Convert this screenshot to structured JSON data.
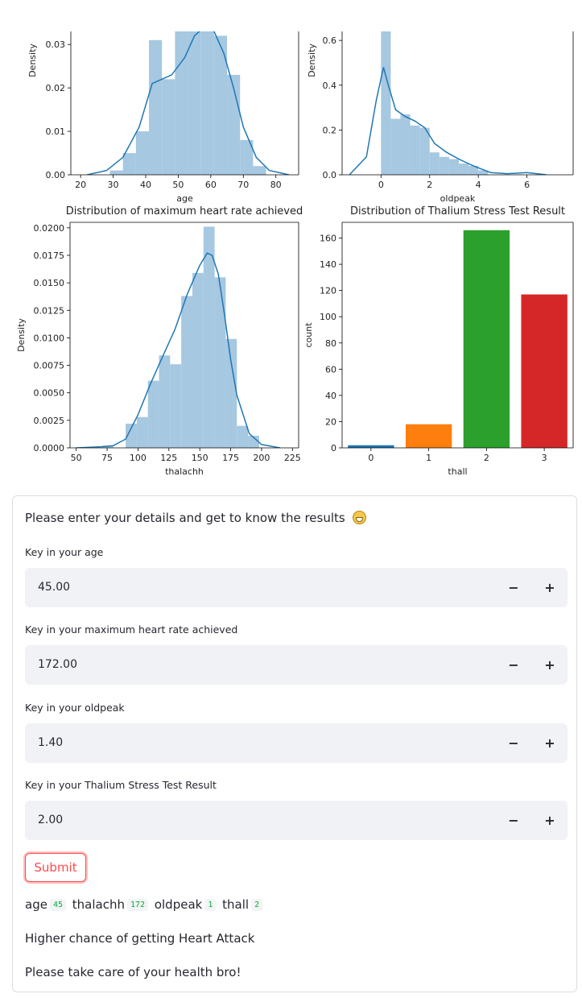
{
  "chart_data": [
    {
      "type": "bar",
      "title": "",
      "xlabel": "age",
      "ylabel": "Density",
      "xlim": [
        17,
        87
      ],
      "ylim": [
        0,
        0.033
      ],
      "xticks": [
        20,
        30,
        40,
        50,
        60,
        70,
        80
      ],
      "yticks": [
        0.0,
        0.01,
        0.02,
        0.03
      ],
      "ytick_labels": [
        "0.00",
        "0.01",
        "0.02",
        "0.03"
      ],
      "bins": [
        [
          29,
          33,
          0.001
        ],
        [
          33,
          37,
          0.005
        ],
        [
          37,
          41,
          0.01
        ],
        [
          41,
          45,
          0.031
        ],
        [
          45,
          49,
          0.022
        ],
        [
          49,
          53,
          0.033
        ],
        [
          53,
          57,
          0.036
        ],
        [
          57,
          61,
          0.038
        ],
        [
          61,
          65,
          0.032
        ],
        [
          65,
          69,
          0.023
        ],
        [
          69,
          73,
          0.008
        ],
        [
          73,
          77,
          0.002
        ]
      ],
      "kde": [
        [
          22,
          0
        ],
        [
          28,
          0.001
        ],
        [
          33,
          0.004
        ],
        [
          38,
          0.011
        ],
        [
          42,
          0.021
        ],
        [
          45,
          0.022
        ],
        [
          48,
          0.023
        ],
        [
          52,
          0.027
        ],
        [
          55,
          0.032
        ],
        [
          58,
          0.034
        ],
        [
          61,
          0.033
        ],
        [
          64,
          0.028
        ],
        [
          67,
          0.02
        ],
        [
          70,
          0.011
        ],
        [
          74,
          0.004
        ],
        [
          78,
          0.001
        ],
        [
          84,
          0
        ]
      ]
    },
    {
      "type": "bar",
      "title": "",
      "xlabel": "oldpeak",
      "ylabel": "Density",
      "xlim": [
        -1.6,
        7.9
      ],
      "ylim": [
        0,
        0.64
      ],
      "xticks": [
        0,
        2,
        4,
        6
      ],
      "yticks": [
        0.0,
        0.2,
        0.4,
        0.6
      ],
      "ytick_labels": [
        "0.0",
        "0.2",
        "0.4",
        "0.6"
      ],
      "bins": [
        [
          0,
          0.4,
          0.64
        ],
        [
          0.4,
          0.8,
          0.25
        ],
        [
          0.8,
          1.2,
          0.27
        ],
        [
          1.2,
          1.6,
          0.22
        ],
        [
          1.6,
          2.0,
          0.21
        ],
        [
          2.0,
          2.4,
          0.1
        ],
        [
          2.4,
          2.8,
          0.08
        ],
        [
          2.8,
          3.2,
          0.07
        ],
        [
          3.2,
          3.6,
          0.05
        ],
        [
          3.6,
          4.0,
          0.04
        ],
        [
          4.0,
          4.4,
          0.02
        ],
        [
          4.4,
          4.8,
          0.0
        ]
      ],
      "kde": [
        [
          -1.3,
          0
        ],
        [
          -0.6,
          0.08
        ],
        [
          -0.2,
          0.33
        ],
        [
          0.1,
          0.48
        ],
        [
          0.3,
          0.4
        ],
        [
          0.6,
          0.29
        ],
        [
          1.0,
          0.26
        ],
        [
          1.4,
          0.24
        ],
        [
          1.8,
          0.21
        ],
        [
          2.2,
          0.14
        ],
        [
          2.7,
          0.1
        ],
        [
          3.2,
          0.07
        ],
        [
          3.8,
          0.04
        ],
        [
          4.5,
          0.01
        ],
        [
          5.2,
          0.005
        ],
        [
          6.0,
          0.01
        ],
        [
          6.8,
          0
        ]
      ]
    },
    {
      "type": "bar",
      "title": "Distribution of maximum heart rate achieved",
      "xlabel": "thalachh",
      "ylabel": "Density",
      "xlim": [
        45,
        230
      ],
      "ylim": [
        0,
        0.0205
      ],
      "xticks": [
        50,
        75,
        100,
        125,
        150,
        175,
        200,
        225
      ],
      "yticks": [
        0,
        0.0025,
        0.005,
        0.0075,
        0.01,
        0.0125,
        0.015,
        0.0175,
        0.02
      ],
      "ytick_labels": [
        "0.0000",
        "0.0025",
        "0.0050",
        "0.0075",
        "0.0100",
        "0.0125",
        "0.0150",
        "0.0175",
        "0.0200"
      ],
      "bins": [
        [
          71,
          80,
          0.0002
        ],
        [
          90,
          99,
          0.0022
        ],
        [
          99,
          108,
          0.0028
        ],
        [
          108,
          117,
          0.0061
        ],
        [
          117,
          126,
          0.0084
        ],
        [
          126,
          135,
          0.0076
        ],
        [
          135,
          144,
          0.0138
        ],
        [
          144,
          153,
          0.0159
        ],
        [
          153,
          162,
          0.0201
        ],
        [
          162,
          171,
          0.0155
        ],
        [
          171,
          180,
          0.0099
        ],
        [
          180,
          189,
          0.002
        ],
        [
          189,
          198,
          0.0011
        ]
      ],
      "kde": [
        [
          50,
          0
        ],
        [
          70,
          0.0001
        ],
        [
          80,
          0.0002
        ],
        [
          90,
          0.0008
        ],
        [
          100,
          0.003
        ],
        [
          110,
          0.0058
        ],
        [
          120,
          0.0083
        ],
        [
          130,
          0.0108
        ],
        [
          140,
          0.014
        ],
        [
          150,
          0.0166
        ],
        [
          156,
          0.0177
        ],
        [
          160,
          0.0175
        ],
        [
          165,
          0.0158
        ],
        [
          170,
          0.0121
        ],
        [
          175,
          0.008
        ],
        [
          180,
          0.0048
        ],
        [
          190,
          0.0013
        ],
        [
          200,
          0.0003
        ],
        [
          215,
          0
        ]
      ]
    },
    {
      "type": "bar",
      "title": "Distribution of Thalium Stress Test Result",
      "xlabel": "thall",
      "ylabel": "count",
      "categories": [
        "0",
        "1",
        "2",
        "3"
      ],
      "values": [
        2,
        18,
        166,
        117
      ],
      "colors": [
        "#1f77b4",
        "#ff7f0e",
        "#2ca02c",
        "#d62728"
      ],
      "ylim": [
        0,
        172
      ],
      "yticks": [
        0,
        20,
        40,
        60,
        80,
        100,
        120,
        140,
        160
      ]
    }
  ],
  "form": {
    "intro": "Please enter your details and get to know the results",
    "intro_emoji": "grimacing-face-emoji",
    "fields": [
      {
        "label": "Key in your age",
        "value": "45.00",
        "minus": "−",
        "plus": "+"
      },
      {
        "label": "Key in your maximum heart rate achieved",
        "value": "172.00",
        "minus": "−",
        "plus": "+"
      },
      {
        "label": "Key in your oldpeak",
        "value": "1.40",
        "minus": "−",
        "plus": "+"
      },
      {
        "label": "Key in your Thalium Stress Test Result",
        "value": "2.00",
        "minus": "−",
        "plus": "+"
      }
    ],
    "submit_label": "Submit"
  },
  "results": {
    "pairs": [
      {
        "key": "age",
        "value": "45"
      },
      {
        "key": "thalachh",
        "value": "172"
      },
      {
        "key": "oldpeak",
        "value": "1"
      },
      {
        "key": "thall",
        "value": "2"
      }
    ],
    "prediction": "Higher chance of getting Heart Attack",
    "advice": "Please take care of your health bro!"
  },
  "colors": {
    "hist_fill": "#a6c8e1",
    "kde_line": "#1f77b4",
    "accent": "#ff4b4b",
    "code_text": "#09ab3b",
    "input_bg": "#f0f2f6"
  }
}
